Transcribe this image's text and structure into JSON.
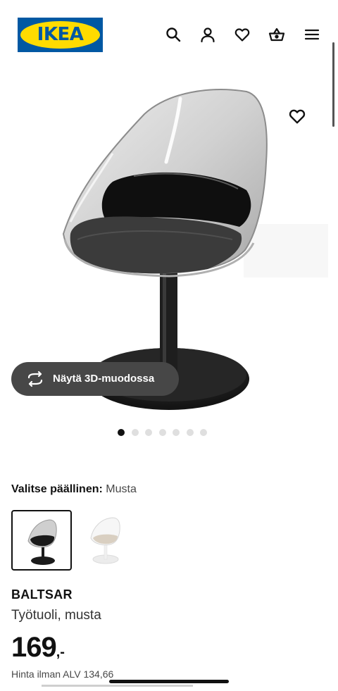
{
  "header": {
    "logo_text": "IKEA",
    "icons": [
      "search-icon",
      "user-icon",
      "heart-icon",
      "basket-icon",
      "menu-icon"
    ]
  },
  "colors": {
    "brand_blue": "#0058a3",
    "brand_yellow": "#ffdb00",
    "text_primary": "#111111",
    "button_dark": "#474747"
  },
  "product_image": {
    "favourite_icon": "heart-icon",
    "view_3d_label": "Näytä 3D-muodossa",
    "view_3d_icon": "rotate-3d-icon",
    "carousel": {
      "total": 7,
      "active_index": 0
    }
  },
  "variants": {
    "label": "Valitse päällinen:",
    "selected_value": "Musta",
    "options": [
      "black-chair-thumbnail",
      "white-chair-thumbnail"
    ],
    "selected_index": 0
  },
  "product": {
    "name": "BALTSAR",
    "description": "Työtuoli, musta",
    "price_integer": "169",
    "price_suffix": ",-",
    "price_note": "Hinta ilman ALV 134,66"
  }
}
